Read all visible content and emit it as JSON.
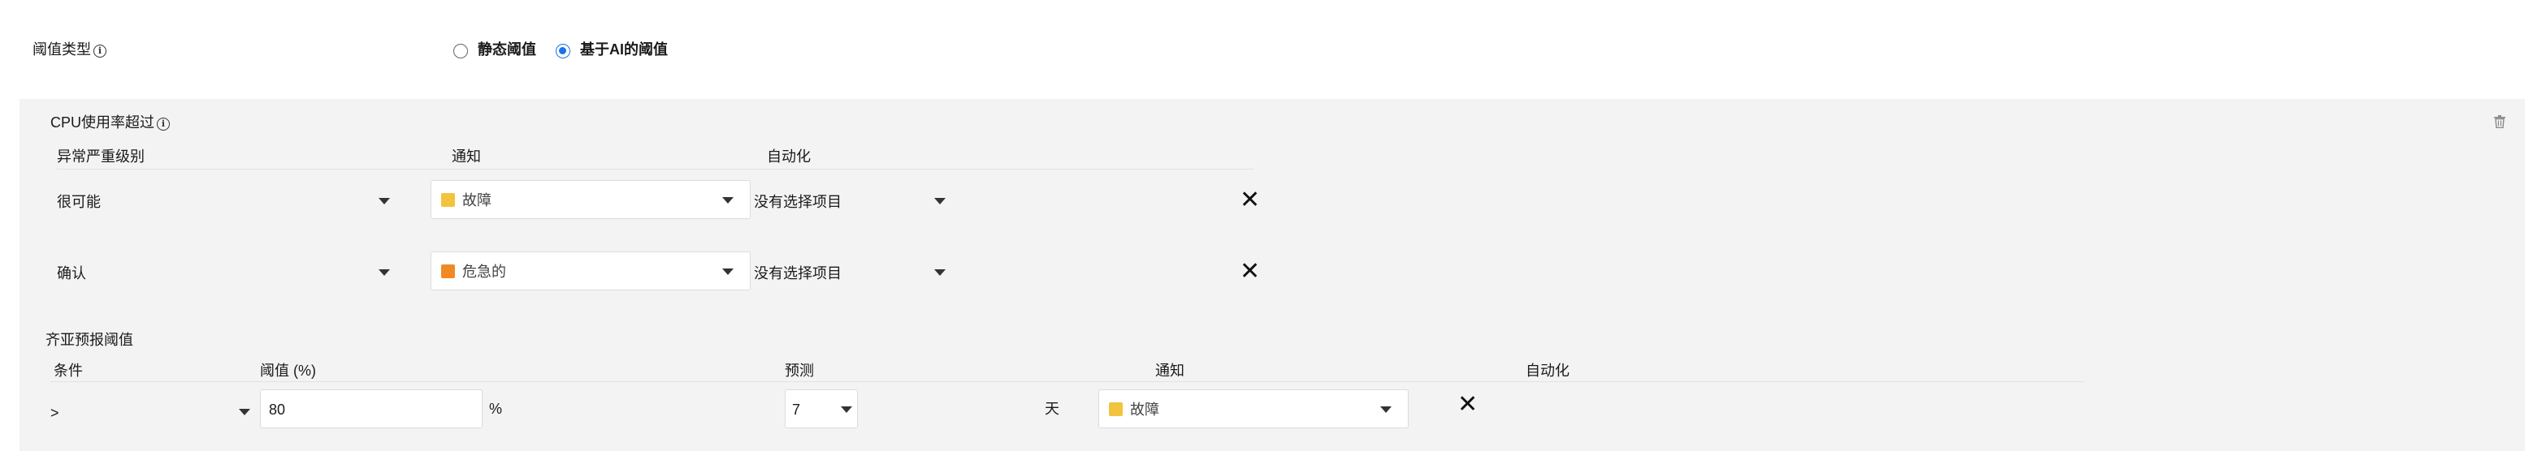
{
  "threshold_type": {
    "label": "阈值类型",
    "options": [
      {
        "label": "静态阈值",
        "selected": false
      },
      {
        "label": "基于AI的阈值",
        "selected": true
      }
    ]
  },
  "cpu_section": {
    "title": "CPU使用率超过",
    "columns": {
      "severity": "异常严重级别",
      "notify": "通知",
      "automation": "自动化"
    },
    "rows": [
      {
        "severity": "很可能",
        "notify": "故障",
        "notify_color": "#f2c43d",
        "automation": "没有选择项目"
      },
      {
        "severity": "确认",
        "notify": "危急的",
        "notify_color": "#f08a24",
        "automation": "没有选择项目"
      }
    ]
  },
  "forecast_section": {
    "title": "齐亚预报阈值",
    "columns": {
      "condition": "条件",
      "threshold": "阈值 (%)",
      "forecast": "预测",
      "notify": "通知",
      "automation": "自动化"
    },
    "row": {
      "condition": ">",
      "threshold_value": "80",
      "unit": "%",
      "forecast_value": "7",
      "forecast_unit": "天",
      "notify": "故障",
      "notify_color": "#f2c43d"
    }
  },
  "icons": {
    "info": "info-icon",
    "trash": "trash-icon",
    "close": "close-icon",
    "dropdown": "chevron-down-icon"
  }
}
